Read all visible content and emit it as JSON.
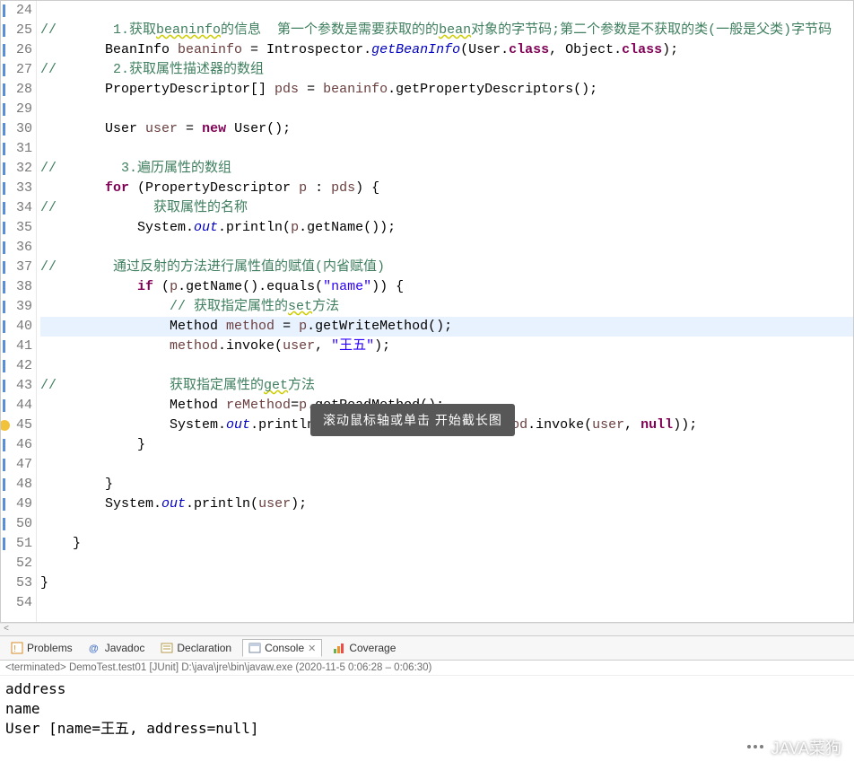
{
  "code": {
    "lines": [
      {
        "n": 24,
        "mark": true,
        "html": ""
      },
      {
        "n": 25,
        "mark": true,
        "html": "<span class='c-comment'>//       1.获取<span class='c-squig'>beaninfo</span>的信息  第一个参数是需要获取的的<span class='c-squig'>bean</span>对象的字节码;第二个参数是不获取的类(一般是父类)字节码</span>"
      },
      {
        "n": 26,
        "mark": true,
        "html": "        BeanInfo <span class='c-local'>beaninfo</span> = Introspector.<span class='c-static'>getBeanInfo</span>(User.<span class='c-keyword'>class</span>, Object.<span class='c-keyword'>class</span>);"
      },
      {
        "n": 27,
        "mark": true,
        "html": "<span class='c-comment'>//       2.获取属性描述器的数组</span>"
      },
      {
        "n": 28,
        "mark": true,
        "html": "        PropertyDescriptor[] <span class='c-local'>pds</span> = <span class='c-local'>beaninfo</span>.getPropertyDescriptors();"
      },
      {
        "n": 29,
        "mark": true,
        "html": ""
      },
      {
        "n": 30,
        "mark": true,
        "html": "        User <span class='c-local'>user</span> = <span class='c-keyword'>new</span> User();"
      },
      {
        "n": 31,
        "mark": true,
        "html": ""
      },
      {
        "n": 32,
        "mark": true,
        "html": "<span class='c-comment'>//        3.遍历属性的数组</span>"
      },
      {
        "n": 33,
        "mark": true,
        "html": "        <span class='c-keyword'>for</span> (PropertyDescriptor <span class='c-local'>p</span> : <span class='c-local'>pds</span>) {"
      },
      {
        "n": 34,
        "mark": true,
        "html": "<span class='c-comment'>//            获取属性的名称</span>"
      },
      {
        "n": 35,
        "mark": true,
        "html": "            System.<span class='c-static'>out</span>.println(<span class='c-local'>p</span>.getName());"
      },
      {
        "n": 36,
        "mark": true,
        "html": ""
      },
      {
        "n": 37,
        "mark": true,
        "html": "<span class='c-comment'>//       通过反射的方法进行属性值的赋值(内省赋值)</span>"
      },
      {
        "n": 38,
        "mark": true,
        "html": "            <span class='c-keyword'>if</span> (<span class='c-local'>p</span>.getName().equals(<span class='c-string'>\"name\"</span>)) {"
      },
      {
        "n": 39,
        "mark": true,
        "html": "                <span class='c-comment'>// 获取指定属性的<span class='c-squig'>set</span>方法</span>"
      },
      {
        "n": 40,
        "mark": true,
        "current": true,
        "html": "                Method <span class='c-local'>method</span> = <span class='c-local'>p</span>.getWriteMethod();"
      },
      {
        "n": 41,
        "mark": true,
        "html": "                <span class='c-local'>method</span>.invoke(<span class='c-local'>user</span>, <span class='c-string'>\"王五\"</span>);"
      },
      {
        "n": 42,
        "mark": true,
        "html": ""
      },
      {
        "n": 43,
        "mark": true,
        "html": "<span class='c-comment'>//              获取指定属性的<span class='c-squig'>get</span>方法</span>"
      },
      {
        "n": 44,
        "mark": true,
        "html": "                Method <span class='c-local'>reMethod</span>=<span class='c-local'>p</span>.getReadMethod();"
      },
      {
        "n": 45,
        "mark": true,
        "warn": true,
        "html": "                System.<span class='c-static'>out</span>.println(<span class='c-string'>\"获取指定属性的值:\"</span>+<span class='c-local'>reMethod</span>.invoke(<span class='c-local'>user</span>, <span class='c-keyword'>null</span>));"
      },
      {
        "n": 46,
        "mark": true,
        "html": "            }"
      },
      {
        "n": 47,
        "mark": true,
        "html": ""
      },
      {
        "n": 48,
        "mark": true,
        "html": "        }"
      },
      {
        "n": 49,
        "mark": true,
        "html": "        System.<span class='c-static'>out</span>.println(<span class='c-local'>user</span>);"
      },
      {
        "n": 50,
        "mark": true,
        "html": ""
      },
      {
        "n": 51,
        "mark": true,
        "html": "    }"
      },
      {
        "n": 52,
        "html": ""
      },
      {
        "n": 53,
        "html": "}"
      },
      {
        "n": 54,
        "html": ""
      }
    ]
  },
  "tabs": {
    "problems": "Problems",
    "javadoc": "Javadoc",
    "declaration": "Declaration",
    "console": "Console",
    "coverage": "Coverage"
  },
  "terminated": "<terminated> DemoTest.test01 [JUnit] D:\\java\\jre\\bin\\javaw.exe  (2020-11-5 0:06:28 – 0:06:30)",
  "console_output": "address\nname\nUser [name=王五, address=null]",
  "tooltip": "滚动鼠标轴或单击  开始截长图",
  "watermark": "JAVA菜狗"
}
